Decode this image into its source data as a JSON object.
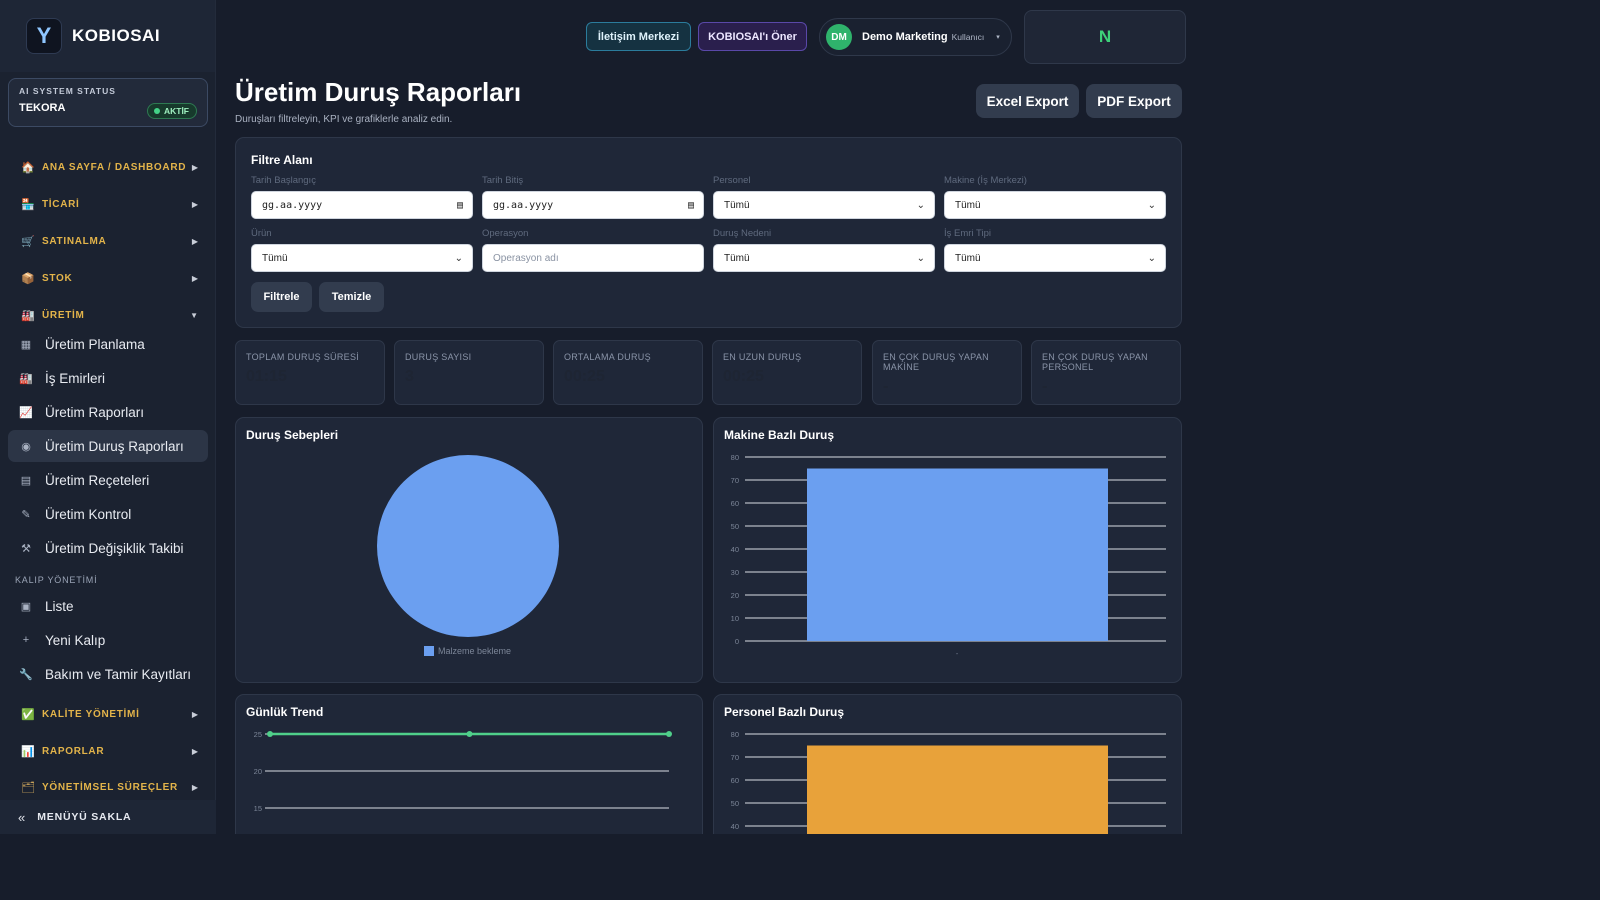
{
  "brand": {
    "logo_letter": "Y",
    "name": "KOBIOSAI"
  },
  "status": {
    "title": "AI SYSTEM STATUS",
    "name": "TEKORA",
    "badge": "AKTİF"
  },
  "nav": {
    "sections": [
      {
        "icon": "🏠",
        "label": "ANA SAYFA / DASHBOARD",
        "arrow": "▶"
      },
      {
        "icon": "🏪",
        "label": "TİCARİ",
        "arrow": "▶"
      },
      {
        "icon": "🛒",
        "label": "SATINALMA",
        "arrow": "▶"
      },
      {
        "icon": "📦",
        "label": "STOK",
        "arrow": "▶"
      },
      {
        "icon": "🏭",
        "label": "ÜRETİM",
        "arrow": "▼"
      },
      {
        "icon": "✅",
        "label": "KALİTE YÖNETİMİ",
        "arrow": "▶"
      },
      {
        "icon": "📊",
        "label": "RAPORLAR",
        "arrow": "▶"
      },
      {
        "icon": "🗂",
        "label": "YÖNETİMSEL SÜREÇLER",
        "arrow": "▶"
      }
    ],
    "sub": [
      {
        "icon": "▦",
        "label": "Üretim Planlama"
      },
      {
        "icon": "🏭",
        "label": "İş Emirleri"
      },
      {
        "icon": "📈",
        "label": "Üretim Raporları"
      },
      {
        "icon": "◉",
        "label": "Üretim Duruş Raporları"
      },
      {
        "icon": "▤",
        "label": "Üretim Reçeteleri"
      },
      {
        "icon": "✎",
        "label": "Üretim Kontrol"
      },
      {
        "icon": "⚒",
        "label": "Üretim Değişiklik Takibi"
      }
    ],
    "group_label": "KALIP YÖNETİMİ",
    "kalip": [
      {
        "icon": "▣",
        "label": "Liste"
      },
      {
        "icon": "+",
        "label": "Yeni Kalıp"
      },
      {
        "icon": "🔧",
        "label": "Bakım ve Tamir Kayıtları"
      }
    ],
    "collapse": {
      "icon": "«",
      "label": "MENÜYÜ SAKLA"
    }
  },
  "topbar": {
    "iletisim": "İletişim Merkezi",
    "oner": "KOBIOSAI'ı Öner",
    "avatar": "DM",
    "user_name": "Demo Marketing",
    "user_role": "Kullanıcı",
    "caret": "▾",
    "n_label": "N"
  },
  "page": {
    "title": "Üretim Duruş Raporları",
    "subtitle": "Duruşları filtreleyin, KPI ve grafiklerle analiz edin.",
    "excel": "Excel Export",
    "pdf": "PDF Export"
  },
  "filter": {
    "title": "Filtre Alanı",
    "fields": [
      {
        "label": "Tarih Başlangıç",
        "value": "gg.aa.yyyy",
        "icon": "▤"
      },
      {
        "label": "Tarih Bitiş",
        "value": "gg.aa.yyyy",
        "icon": "▤"
      },
      {
        "label": "Personel",
        "value": "Tümü",
        "icon": "⌄"
      },
      {
        "label": "Makine (İş Merkezi)",
        "value": "Tümü",
        "icon": "⌄"
      },
      {
        "label": "Ürün",
        "value": "Tümü",
        "icon": "⌄"
      },
      {
        "label": "Operasyon",
        "placeholder": "Operasyon adı"
      },
      {
        "label": "Duruş Nedeni",
        "value": "Tümü",
        "icon": "⌄"
      },
      {
        "label": "İş Emri Tipi",
        "value": "Tümü",
        "icon": "⌄"
      }
    ],
    "apply": "Filtrele",
    "clear": "Temizle"
  },
  "kpis": [
    {
      "label": "TOPLAM DURUŞ SÜRESİ",
      "value": "01:15"
    },
    {
      "label": "DURUŞ SAYISI",
      "value": "3"
    },
    {
      "label": "ORTALAMA DURUŞ",
      "value": "00:25"
    },
    {
      "label": "EN UZUN DURUŞ",
      "value": "00:25"
    },
    {
      "label": "EN ÇOK DURUŞ YAPAN MAKİNE",
      "value": "-"
    },
    {
      "label": "EN ÇOK DURUŞ YAPAN PERSONEL",
      "value": "-"
    }
  ],
  "chart_data": [
    {
      "type": "pie",
      "title": "Duruş Sebepleri",
      "categories": [
        "Malzeme bekleme"
      ],
      "values": [
        100
      ],
      "colors": [
        "#6b9ff0"
      ],
      "legend": "bottom"
    },
    {
      "type": "bar",
      "title": "Makine Bazlı Duruş",
      "categories": [
        "-"
      ],
      "values": [
        75
      ],
      "ylim": [
        0,
        80
      ],
      "yticks": [
        0,
        10,
        20,
        30,
        40,
        50,
        60,
        70,
        80
      ],
      "color": "#6b9ff0",
      "grid": true
    },
    {
      "type": "line",
      "title": "Günlük Trend",
      "x": [
        "",
        "",
        ""
      ],
      "values": [
        25,
        25,
        25
      ],
      "yticks": [
        25,
        20,
        15
      ],
      "color": "#4fcf8a",
      "grid": true
    },
    {
      "type": "bar",
      "title": "Personel Bazlı Duruş",
      "values": [
        75
      ],
      "ylim": [
        40,
        80
      ],
      "yticks": [
        80,
        70,
        60,
        50,
        40
      ],
      "color": "#e8a23a",
      "grid": true
    }
  ]
}
